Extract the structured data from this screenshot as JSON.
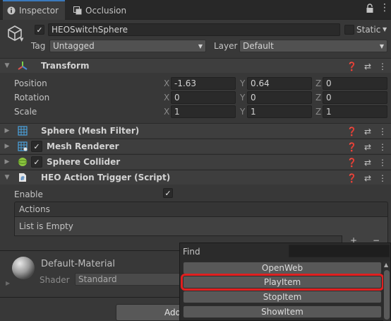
{
  "tabs": {
    "inspector": "Inspector",
    "occlusion": "Occlusion"
  },
  "object": {
    "name": "HEOSwitchSphere",
    "static_label": "Static",
    "tag_label": "Tag",
    "tag_value": "Untagged",
    "layer_label": "Layer",
    "layer_value": "Default"
  },
  "transform": {
    "title": "Transform",
    "position_label": "Position",
    "rotation_label": "Rotation",
    "scale_label": "Scale",
    "axes": [
      "X",
      "Y",
      "Z"
    ],
    "position": [
      "-1.63",
      "0.64",
      "0"
    ],
    "rotation": [
      "0",
      "0",
      "0"
    ],
    "scale": [
      "1",
      "1",
      "1"
    ]
  },
  "components": {
    "mesh_filter": "Sphere (Mesh Filter)",
    "mesh_renderer": "Mesh Renderer",
    "sphere_collider": "Sphere Collider",
    "heo_trigger": "HEO Action Trigger (Script)"
  },
  "trigger": {
    "enable_label": "Enable",
    "actions_label": "Actions",
    "empty_text": "List is Empty",
    "plus": "+",
    "minus": "−"
  },
  "material": {
    "name": "Default-Material",
    "shader_label": "Shader",
    "shader_value": "Standard"
  },
  "add_button": "Add",
  "popup": {
    "find_label": "Find",
    "find_value": "",
    "items": [
      "OpenWeb",
      "PlayItem",
      "StopItem",
      "ShowItem"
    ]
  },
  "colors": {
    "accent": "#3a79bb",
    "highlight": "#e02020"
  }
}
